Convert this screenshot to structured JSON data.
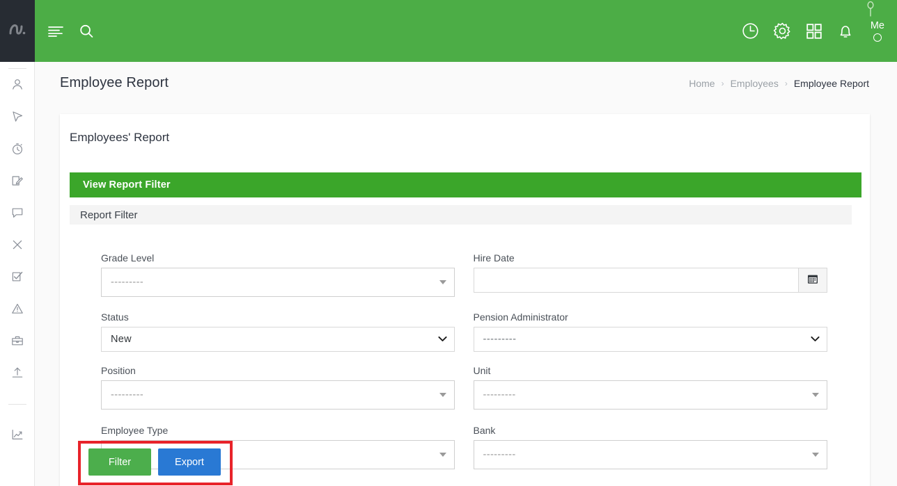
{
  "app": {
    "logo_icon": "app-logo-icon",
    "accent_green": "#4cad46",
    "section_green": "#3ba62a",
    "sidebar_dark": "#272c33",
    "highlight_red": "#e8232a",
    "filter_button_green": "#4cae4c",
    "export_button_blue": "#2979d4"
  },
  "topbar": {
    "menu_toggle_icon": "hamburger-menu-icon",
    "search_icon": "search-icon",
    "history_icon": "clock-icon",
    "settings_icon": "gear-icon",
    "apps_icon": "grid-apps-icon",
    "notifications_icon": "bell-icon",
    "pin_icon": "pin-icon",
    "user_label": "Me",
    "avatar_icon": "avatar-circle-icon"
  },
  "sidebar": {
    "items": [
      {
        "name": "employees",
        "icon": "person-icon"
      },
      {
        "name": "cursor",
        "icon": "cursor-arrow-icon"
      },
      {
        "name": "time-tracking",
        "icon": "stopwatch-icon"
      },
      {
        "name": "edit",
        "icon": "edit-pencil-icon"
      },
      {
        "name": "messages",
        "icon": "chat-bubble-icon"
      },
      {
        "name": "close",
        "icon": "x-close-icon"
      },
      {
        "name": "tasks",
        "icon": "checkbox-check-icon"
      },
      {
        "name": "alerts",
        "icon": "warning-triangle-icon"
      },
      {
        "name": "jobs",
        "icon": "briefcase-icon"
      },
      {
        "name": "upload",
        "icon": "upload-arrow-icon"
      },
      {
        "name": "reports",
        "icon": "chart-line-icon"
      }
    ]
  },
  "page": {
    "title": "Employee Report",
    "breadcrumb": [
      {
        "label": "Home",
        "active": false
      },
      {
        "label": "Employees",
        "active": false
      },
      {
        "label": "Employee Report",
        "active": true
      }
    ],
    "breadcrumb_separator": "›"
  },
  "card": {
    "title": "Employees' Report",
    "filter_bar_label": "View Report Filter",
    "legend_label": "Report Filter"
  },
  "form": {
    "placeholder_dashes": "---------",
    "fields": {
      "grade_level": {
        "label": "Grade Level",
        "value": "---------",
        "type": "select2"
      },
      "hire_date": {
        "label": "Hire Date",
        "value": "",
        "placeholder": "",
        "type": "date",
        "addon_icon": "calendar-icon"
      },
      "status": {
        "label": "Status",
        "value": "New",
        "type": "select"
      },
      "pension_administrator": {
        "label": "Pension Administrator",
        "value": "---------",
        "type": "select"
      },
      "position": {
        "label": "Position",
        "value": "---------",
        "type": "select2"
      },
      "unit": {
        "label": "Unit",
        "value": "---------",
        "type": "select2"
      },
      "employee_type": {
        "label": "Employee Type",
        "value": "---------",
        "type": "select2"
      },
      "bank": {
        "label": "Bank",
        "value": "---------",
        "type": "select2"
      }
    }
  },
  "actions": {
    "filter_label": "Filter",
    "export_label": "Export"
  }
}
